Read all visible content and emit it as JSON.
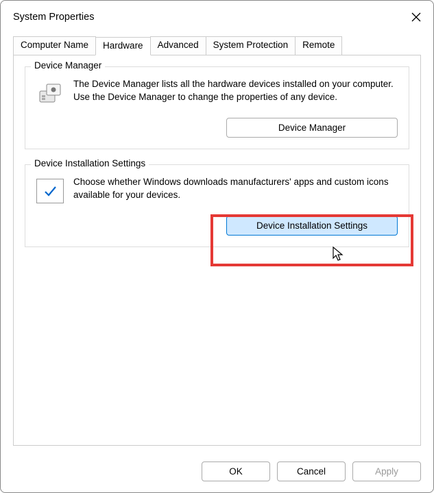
{
  "window": {
    "title": "System Properties"
  },
  "tabs": {
    "t0": "Computer Name",
    "t1": "Hardware",
    "t2": "Advanced",
    "t3": "System Protection",
    "t4": "Remote",
    "active": "Hardware"
  },
  "deviceManager": {
    "legend": "Device Manager",
    "description": "The Device Manager lists all the hardware devices installed on your computer. Use the Device Manager to change the properties of any device.",
    "button": "Device Manager"
  },
  "deviceInstall": {
    "legend": "Device Installation Settings",
    "description": "Choose whether Windows downloads manufacturers' apps and custom icons available for your devices.",
    "button": "Device Installation Settings"
  },
  "buttons": {
    "ok": "OK",
    "cancel": "Cancel",
    "apply": "Apply"
  }
}
